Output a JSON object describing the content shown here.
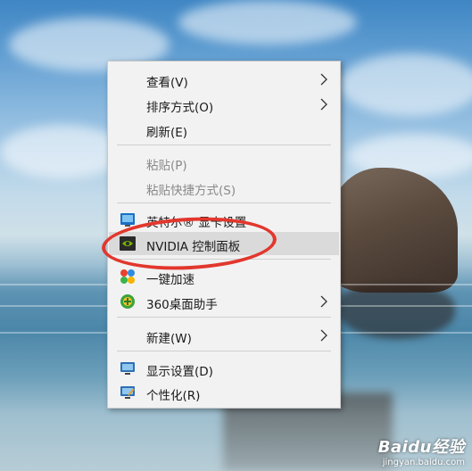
{
  "menu": {
    "items": [
      {
        "label": "查看(V)",
        "submenu": true,
        "disabled": false,
        "icon": null
      },
      {
        "label": "排序方式(O)",
        "submenu": true,
        "disabled": false,
        "icon": null
      },
      {
        "label": "刷新(E)",
        "submenu": false,
        "disabled": false,
        "icon": null
      },
      {
        "label": "粘贴(P)",
        "submenu": false,
        "disabled": true,
        "icon": null
      },
      {
        "label": "粘贴快捷方式(S)",
        "submenu": false,
        "disabled": true,
        "icon": null
      },
      {
        "label": "英特尔® 显卡设置",
        "submenu": false,
        "disabled": false,
        "icon": "intel-graphics-icon"
      },
      {
        "label": "NVIDIA 控制面板",
        "submenu": false,
        "disabled": false,
        "icon": "nvidia-icon",
        "highlighted": true
      },
      {
        "label": "一键加速",
        "submenu": false,
        "disabled": false,
        "icon": "speedup-icon"
      },
      {
        "label": "360桌面助手",
        "submenu": true,
        "disabled": false,
        "icon": "360-assistant-icon"
      },
      {
        "label": "新建(W)",
        "submenu": true,
        "disabled": false,
        "icon": null
      },
      {
        "label": "显示设置(D)",
        "submenu": false,
        "disabled": false,
        "icon": "display-settings-icon"
      },
      {
        "label": "个性化(R)",
        "submenu": false,
        "disabled": false,
        "icon": "personalize-icon"
      }
    ]
  },
  "annotation": {
    "color": "#e2372d"
  },
  "watermark": {
    "logo": "Baidu经验",
    "url": "jingyan.baidu.com"
  }
}
